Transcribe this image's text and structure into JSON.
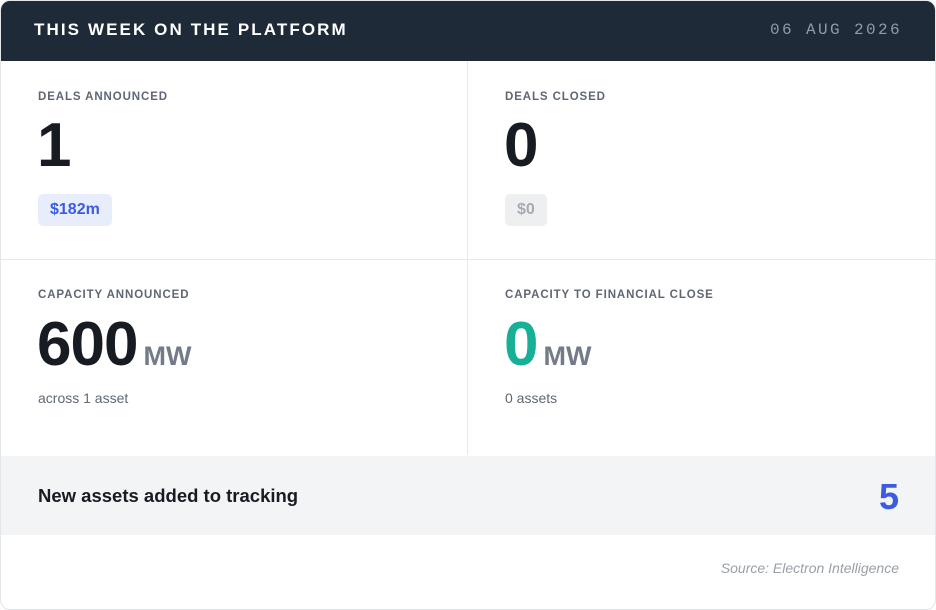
{
  "header": {
    "title": "THIS WEEK ON THE PLATFORM",
    "date": "06 AUG 2026"
  },
  "stats": {
    "deals_announced": {
      "label": "DEALS ANNOUNCED",
      "value": "1",
      "badge": "$182m"
    },
    "deals_closed": {
      "label": "DEALS CLOSED",
      "value": "0",
      "badge": "$0"
    },
    "capacity_announced": {
      "label": "CAPACITY ANNOUNCED",
      "value": "600",
      "unit": "MW",
      "subtext": "across 1 asset"
    },
    "capacity_financial_close": {
      "label": "CAPACITY TO FINANCIAL CLOSE",
      "value": "0",
      "unit": "MW",
      "subtext": "0 assets"
    }
  },
  "new_assets": {
    "label": "New assets added to tracking",
    "value": "5"
  },
  "source": "Source: Electron Intelligence",
  "colors": {
    "header_bg": "#1f2a38",
    "accent_blue": "#3b5be0",
    "accent_teal": "#17b096",
    "band_bg": "#f3f4f6"
  }
}
